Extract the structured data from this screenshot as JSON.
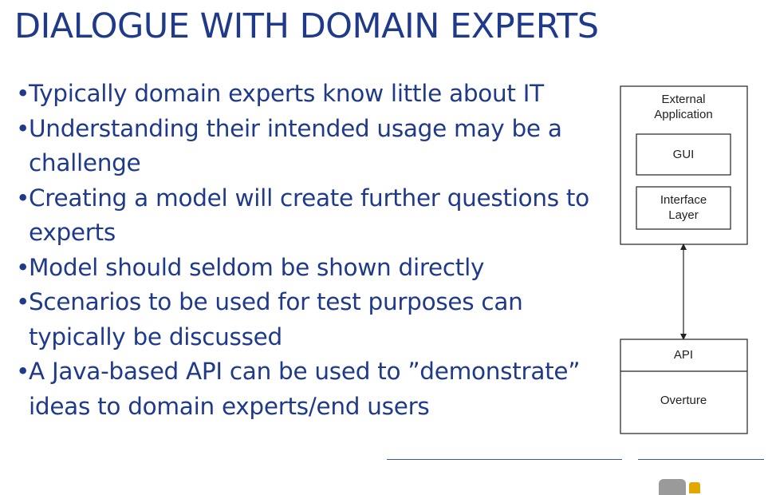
{
  "slide": {
    "title": "DIALOGUE WITH DOMAIN EXPERTS",
    "bullets": [
      "Typically domain experts know little about IT",
      "Understanding their intended usage may be a challenge",
      "Creating a model will create further questions to experts",
      "Model should seldom be shown directly",
      "Scenarios to be used for test purposes can typically be discussed",
      "A Java-based API can be used to ”demonstrate” ideas to domain experts/end users"
    ]
  },
  "diagram": {
    "external_application": [
      "External",
      "Application"
    ],
    "gui": "GUI",
    "interface_layer": [
      "Interface",
      "Layer"
    ],
    "api": "API",
    "overture": "Overture"
  },
  "colors": {
    "text": "#1f3a8a",
    "diagram_stroke": "#222222",
    "rule": "#3a5a9a"
  }
}
